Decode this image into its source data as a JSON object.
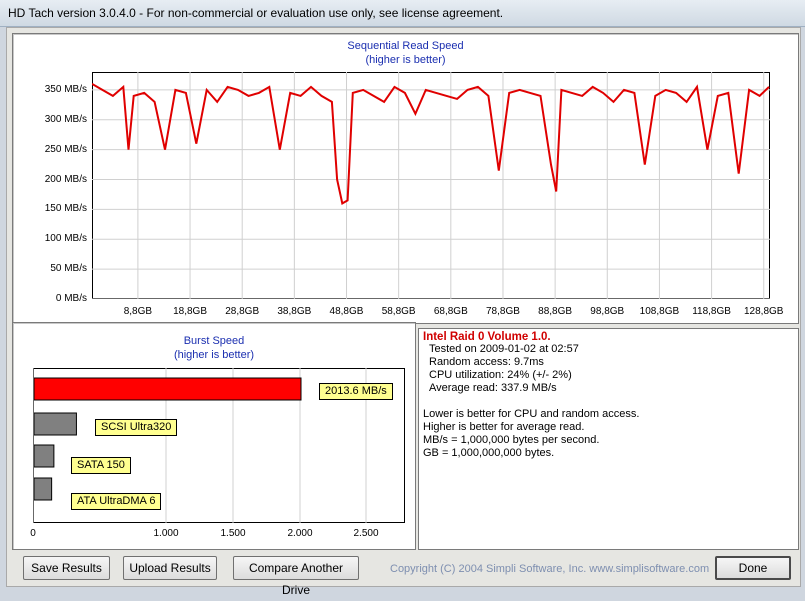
{
  "window": {
    "title": "HD Tach version 3.0.4.0  - For non-commercial or evaluation use only, see license agreement."
  },
  "seq_chart": {
    "title": "Sequential Read Speed",
    "subtitle": "(higher is better)",
    "line_color": "#e00000",
    "yticks": [
      "350 MB/s",
      "300 MB/s",
      "250 MB/s",
      "200 MB/s",
      "150 MB/s",
      "100 MB/s",
      "50 MB/s",
      "0 MB/s"
    ],
    "xticks": [
      "8,8GB",
      "18,8GB",
      "28,8GB",
      "38,8GB",
      "48,8GB",
      "58,8GB",
      "68,8GB",
      "78,8GB",
      "88,8GB",
      "98,8GB",
      "108,8GB",
      "118,8GB",
      "128,8GB"
    ]
  },
  "burst_chart": {
    "title": "Burst Speed",
    "subtitle": "(higher is better)",
    "xticks": [
      "0",
      "1.000",
      "1.500",
      "2.000",
      "2.500"
    ]
  },
  "chart_data": [
    {
      "type": "line",
      "title": "Sequential Read Speed",
      "subtitle": "(higher is better)",
      "xlabel": "",
      "ylabel": "",
      "ylim": [
        0,
        380
      ],
      "xlim": [
        0,
        130
      ],
      "x": [
        0,
        2,
        4,
        6,
        7,
        8,
        10,
        12,
        14,
        16,
        18,
        20,
        22,
        24,
        26,
        28,
        30,
        32,
        34,
        36,
        38,
        40,
        42,
        44,
        46,
        47,
        48,
        49,
        50,
        52,
        54,
        56,
        58,
        60,
        62,
        64,
        66,
        68,
        70,
        72,
        74,
        76,
        78,
        80,
        82,
        84,
        86,
        88,
        89,
        90,
        92,
        94,
        96,
        98,
        100,
        102,
        104,
        106,
        108,
        110,
        112,
        114,
        116,
        118,
        120,
        122,
        124,
        126,
        128,
        130
      ],
      "series": [
        {
          "values": [
            360,
            350,
            340,
            355,
            250,
            340,
            345,
            330,
            250,
            350,
            345,
            260,
            350,
            330,
            355,
            350,
            340,
            345,
            355,
            250,
            345,
            340,
            355,
            340,
            330,
            200,
            160,
            165,
            345,
            350,
            340,
            330,
            355,
            345,
            310,
            350,
            345,
            340,
            335,
            350,
            355,
            340,
            215,
            345,
            350,
            345,
            340,
            225,
            180,
            350,
            345,
            340,
            355,
            345,
            330,
            350,
            345,
            225,
            340,
            350,
            345,
            330,
            355,
            250,
            340,
            345,
            210,
            350,
            340,
            355
          ]
        }
      ],
      "grid": true
    },
    {
      "type": "bar",
      "title": "Burst Speed",
      "subtitle": "(higher is better)",
      "categories": [
        "",
        "SCSI Ultra320",
        "SATA 150",
        "ATA UltraDMA 6"
      ],
      "values": [
        2013.6,
        320,
        150,
        133
      ],
      "value_labels": [
        "2013.6 MB/s",
        "",
        "",
        ""
      ],
      "colors": [
        "#ff0000",
        "#808080",
        "#808080",
        "#808080"
      ],
      "xlim": [
        0,
        2800
      ],
      "xticks": [
        "0",
        "1.000",
        "1.500",
        "2.000",
        "2.500"
      ]
    }
  ],
  "info": {
    "heading": "Intel Raid 0 Volume 1.0.",
    "tested": "Tested on 2009-01-02 at 02:57",
    "random_access": "Random access: 9.7ms",
    "cpu": "CPU utilization: 24% (+/- 2%)",
    "avg_read": "Average read: 337.9 MB/s",
    "note1": "Lower is better for CPU and random access.",
    "note2": "Higher is better for average read.",
    "note3": "MB/s = 1,000,000 bytes per second.",
    "note4": "GB = 1,000,000,000 bytes."
  },
  "buttons": {
    "save": "Save Results",
    "upload": "Upload Results",
    "compare": "Compare Another Drive",
    "done": "Done"
  },
  "copyright": "Copyright (C) 2004 Simpli Software, Inc. www.simplisoftware.com"
}
